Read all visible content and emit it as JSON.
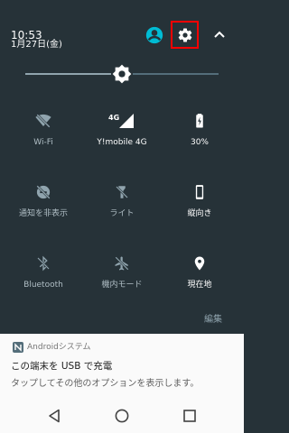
{
  "status": {
    "time": "10:53",
    "date": "1月27日(金)"
  },
  "brightness": {
    "level": 0.45
  },
  "tiles": [
    {
      "label": "Wi-Fi",
      "icon": "wifi-off-icon",
      "active": false
    },
    {
      "label": "Y!mobile 4G",
      "icon": "cellular-signal-icon",
      "badge": "4G",
      "active": true
    },
    {
      "label": "30%",
      "icon": "battery-charging-icon",
      "active": true
    },
    {
      "label": "通知を非表示",
      "icon": "do-not-disturb-off-icon",
      "active": false
    },
    {
      "label": "ライト",
      "icon": "flashlight-off-icon",
      "active": false
    },
    {
      "label": "縦向き",
      "icon": "portrait-phone-icon",
      "active": true
    },
    {
      "label": "Bluetooth",
      "icon": "bluetooth-off-icon",
      "active": false
    },
    {
      "label": "機内モード",
      "icon": "airplane-off-icon",
      "active": false
    },
    {
      "label": "現在地",
      "icon": "location-pin-icon",
      "active": true
    }
  ],
  "edit_label": "編集",
  "notification": {
    "app": "Androidシステム",
    "title": "この端末を USB で充電",
    "text": "タップしてその他のオプションを表示します。"
  },
  "colors": {
    "shade_bg": "#263238",
    "accent": "#00bcd4",
    "highlight_box": "#ff0000"
  }
}
